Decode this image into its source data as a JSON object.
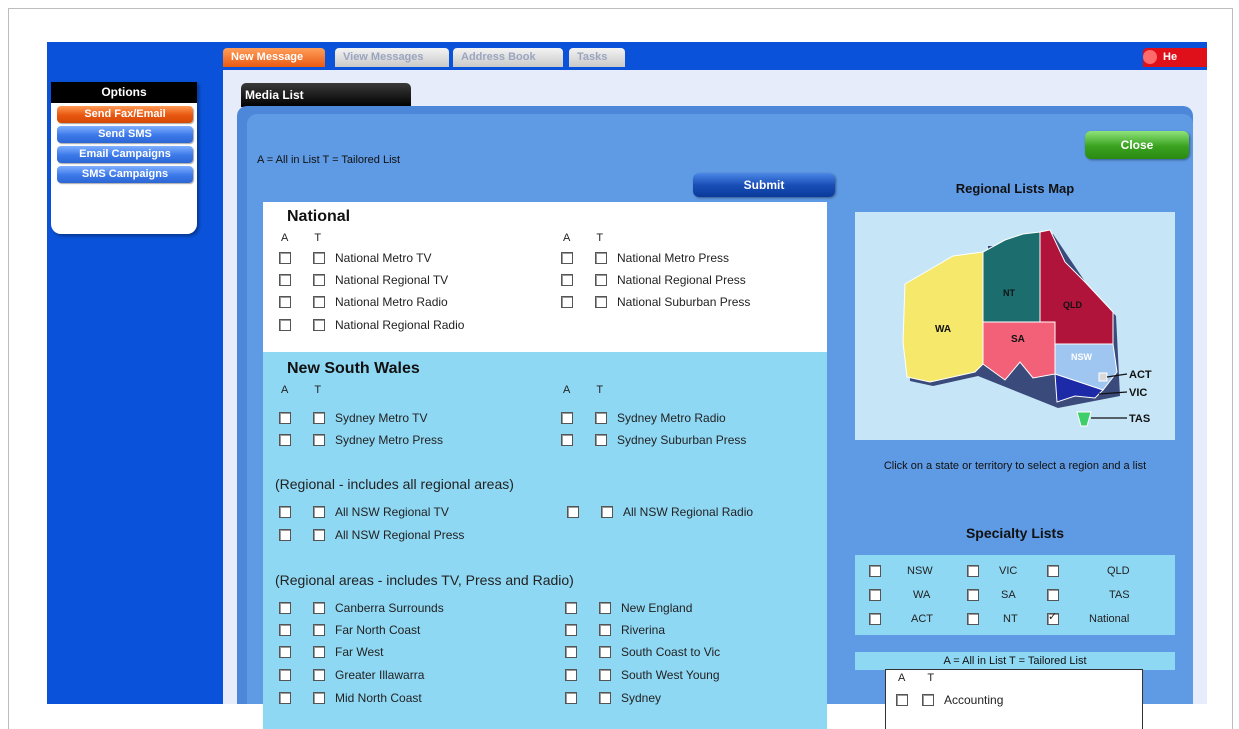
{
  "options": {
    "title": "Options",
    "items": [
      {
        "label": "Send Fax/Email",
        "active": true
      },
      {
        "label": "Send SMS",
        "active": false
      },
      {
        "label": "Email Campaigns",
        "active": false
      },
      {
        "label": "SMS Campaigns",
        "active": false
      }
    ]
  },
  "tabs": [
    {
      "label": "New Message",
      "active": true
    },
    {
      "label": "View Messages",
      "active": false
    },
    {
      "label": "Address Book",
      "active": false
    },
    {
      "label": "Tasks",
      "active": false
    }
  ],
  "help_label": "He",
  "media_tab": "Media List",
  "legend": "A = All in List   T = Tailored List",
  "submit_label": "Submit",
  "close_label": "Close",
  "at_header": {
    "a": "A",
    "t": "T"
  },
  "national": {
    "title": "National",
    "left": [
      "National Metro TV",
      "National Regional TV",
      "National Metro Radio",
      "National Regional Radio"
    ],
    "right": [
      "National Metro Press",
      "National Regional Press",
      "National Suburban Press"
    ]
  },
  "nsw": {
    "title": "New South Wales",
    "left": [
      "Sydney Metro TV",
      "Sydney Metro Press"
    ],
    "right": [
      "Sydney Metro Radio",
      "Sydney Suburban Press"
    ],
    "regional_title": "(Regional - includes all regional areas)",
    "regional_left": [
      "All NSW Regional TV",
      "All NSW Regional Press"
    ],
    "regional_right": [
      "All NSW Regional Radio"
    ],
    "areas_title": "(Regional areas - includes TV, Press and Radio)",
    "areas_left": [
      "Canberra Surrounds",
      "Far North Coast",
      "Far West",
      "Greater Illawarra",
      "Mid North Coast"
    ],
    "areas_right": [
      "New England",
      "Riverina",
      "South Coast to Vic",
      "South West Young",
      "Sydney"
    ]
  },
  "map": {
    "title": "Regional Lists Map",
    "labels": {
      "wa": "WA",
      "nt": "NT",
      "qld": "QLD",
      "sa": "SA",
      "nsw": "NSW",
      "act": "ACT",
      "vic": "VIC",
      "tas": "TAS"
    },
    "colors": {
      "wa": "#f5e86a",
      "nt": "#1c6e6e",
      "qld": "#b0143a",
      "sa": "#f26177",
      "nsw": "#9fc6f0",
      "vic": "#1d2aa8",
      "tas": "#3ecf6a",
      "act": "#d9d9d9"
    },
    "hint": "Click on a state or territory to select a region and a list"
  },
  "specialty": {
    "title": "Specialty Lists",
    "items": [
      {
        "label": "NSW",
        "checked": false
      },
      {
        "label": "VIC",
        "checked": false
      },
      {
        "label": "QLD",
        "checked": false
      },
      {
        "label": "WA",
        "checked": false
      },
      {
        "label": "SA",
        "checked": false
      },
      {
        "label": "TAS",
        "checked": false
      },
      {
        "label": "ACT",
        "checked": false
      },
      {
        "label": "NT",
        "checked": false
      },
      {
        "label": "National",
        "checked": true
      }
    ],
    "legend": "A = All in List   T = Tailored List",
    "lists": [
      "Accounting"
    ]
  }
}
